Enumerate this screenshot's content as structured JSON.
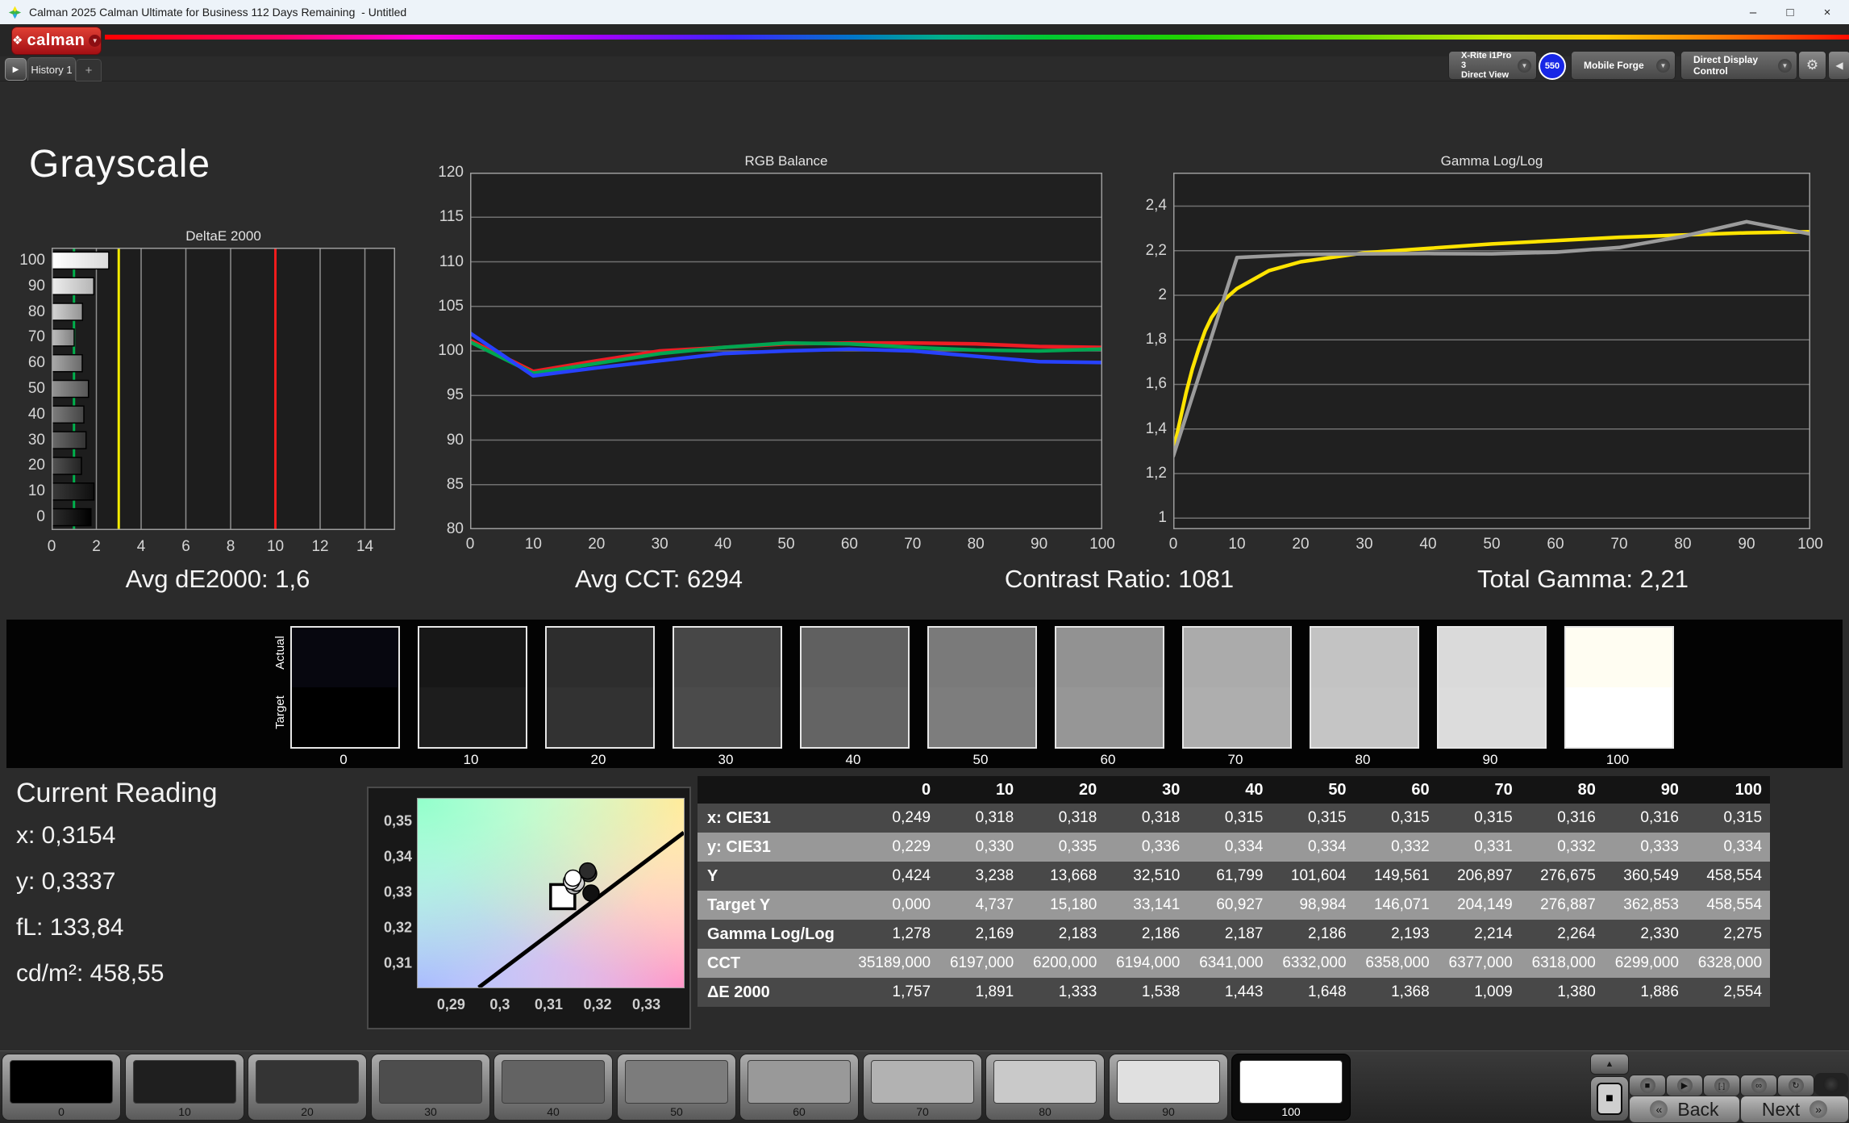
{
  "window": {
    "title": "Calman 2025 Calman Ultimate for Business 112 Days Remaining  - Untitled",
    "minimize": "–",
    "maximize": "□",
    "close": "×"
  },
  "brand": {
    "logo_text": "calman",
    "diamond": "❖",
    "caret": "▼",
    "accent_red": "#b5121b"
  },
  "tabs": {
    "panel_toggle_icon": "▶",
    "history": "History 1",
    "add": "+"
  },
  "meters": {
    "caret": "▼",
    "meter1_line1": "X-Rite i1Pro 3",
    "meter1_line2": "Direct View",
    "meter1_stripe": "#17d117",
    "meter1_badge": "550",
    "meter2_label": "Mobile Forge",
    "meter2_stripe": "#17d117",
    "meter3_label": "Direct Display Control",
    "meter3_stripe": "#e3d400",
    "gear_icon": "⚙",
    "collapse_icon": "◀"
  },
  "page": {
    "title": "Grayscale"
  },
  "summary": {
    "s1": "Avg dE2000: 1,6",
    "s2": "Avg CCT: 6294",
    "s3": "Contrast Ratio: 1081",
    "s4": "Total Gamma: 2,21"
  },
  "strip": {
    "actual_label": "Actual",
    "target_label": "Target",
    "items": [
      {
        "label": "0",
        "actual": "#07070f",
        "target": "#000000"
      },
      {
        "label": "10",
        "actual": "#171717",
        "target": "#1d1d1d"
      },
      {
        "label": "20",
        "actual": "#2d2d2d",
        "target": "#323232"
      },
      {
        "label": "30",
        "actual": "#474747",
        "target": "#4b4b4b"
      },
      {
        "label": "40",
        "actual": "#606060",
        "target": "#646464"
      },
      {
        "label": "50",
        "actual": "#7a7a7a",
        "target": "#7d7d7d"
      },
      {
        "label": "60",
        "actual": "#929292",
        "target": "#969696"
      },
      {
        "label": "70",
        "actual": "#ababab",
        "target": "#aeaeae"
      },
      {
        "label": "80",
        "actual": "#c3c3c3",
        "target": "#c5c5c5"
      },
      {
        "label": "90",
        "actual": "#dadada",
        "target": "#dcdcdc"
      },
      {
        "label": "100",
        "actual": "#fffdf2",
        "target": "#ffffff"
      }
    ]
  },
  "current_reading": {
    "title": "Current Reading",
    "x": "x: 0,3154",
    "y": "y: 0,3337",
    "fl": "fL: 133,84",
    "cd": "cd/m²: 458,55"
  },
  "table": {
    "columns": [
      "",
      "0",
      "10",
      "20",
      "30",
      "40",
      "50",
      "60",
      "70",
      "80",
      "90",
      "100"
    ],
    "rows": [
      {
        "label": "x: CIE31",
        "values": [
          "0,249",
          "0,318",
          "0,318",
          "0,318",
          "0,315",
          "0,315",
          "0,315",
          "0,315",
          "0,316",
          "0,316",
          "0,315"
        ]
      },
      {
        "label": "y: CIE31",
        "values": [
          "0,229",
          "0,330",
          "0,335",
          "0,336",
          "0,334",
          "0,334",
          "0,332",
          "0,331",
          "0,332",
          "0,333",
          "0,334"
        ]
      },
      {
        "label": "Y",
        "values": [
          "0,424",
          "3,238",
          "13,668",
          "32,510",
          "61,799",
          "101,604",
          "149,561",
          "206,897",
          "276,675",
          "360,549",
          "458,554"
        ]
      },
      {
        "label": "Target Y",
        "values": [
          "0,000",
          "4,737",
          "15,180",
          "33,141",
          "60,927",
          "98,984",
          "146,071",
          "204,149",
          "276,887",
          "362,853",
          "458,554"
        ]
      },
      {
        "label": "Gamma Log/Log",
        "values": [
          "1,278",
          "2,169",
          "2,183",
          "2,186",
          "2,187",
          "2,186",
          "2,193",
          "2,214",
          "2,264",
          "2,330",
          "2,275"
        ]
      },
      {
        "label": "CCT",
        "values": [
          "35189,000",
          "6197,000",
          "6200,000",
          "6194,000",
          "6341,000",
          "6332,000",
          "6358,000",
          "6377,000",
          "6318,000",
          "6299,000",
          "6328,000"
        ]
      },
      {
        "label": "ΔE 2000",
        "values": [
          "1,757",
          "1,891",
          "1,333",
          "1,538",
          "1,443",
          "1,648",
          "1,368",
          "1,009",
          "1,380",
          "1,886",
          "2,554"
        ]
      }
    ]
  },
  "bottom": {
    "patches": [
      {
        "label": "0",
        "color": "#000000"
      },
      {
        "label": "10",
        "color": "#1f1f1f"
      },
      {
        "label": "20",
        "color": "#343434"
      },
      {
        "label": "30",
        "color": "#4d4d4d"
      },
      {
        "label": "40",
        "color": "#636363"
      },
      {
        "label": "50",
        "color": "#7c7c7c"
      },
      {
        "label": "60",
        "color": "#999999"
      },
      {
        "label": "70",
        "color": "#b2b2b2"
      },
      {
        "label": "80",
        "color": "#c9c9c9"
      },
      {
        "label": "90",
        "color": "#e0e0e0"
      },
      {
        "label": "100",
        "color": "#ffffff"
      }
    ],
    "selected_label": "100",
    "back": "Back",
    "next": "Next",
    "back_chevron": "«",
    "next_chevron": "»",
    "icons": {
      "up": "▲",
      "square": "■",
      "stop": "■",
      "play": "▶",
      "step": "[·]",
      "loop": "∞",
      "refresh": "↻"
    }
  },
  "chart_data": [
    {
      "id": "deltae_2000",
      "type": "bar",
      "orientation": "horizontal",
      "title": "DeltaE 2000",
      "categories": [
        0,
        10,
        20,
        30,
        40,
        50,
        60,
        70,
        80,
        90,
        100
      ],
      "values": [
        1.757,
        1.891,
        1.333,
        1.538,
        1.443,
        1.648,
        1.368,
        1.009,
        1.38,
        1.886,
        2.554
      ],
      "display_order": "100-top-to-0-bottom",
      "xlim": [
        0,
        15.35
      ],
      "xticks": [
        0,
        2,
        4,
        6,
        8,
        10,
        12,
        14
      ],
      "grid": "vertical",
      "ref_lines": [
        {
          "x": 1,
          "color": "#00b14c"
        },
        {
          "x": 3,
          "color": "#f5ec00"
        },
        {
          "x": 10,
          "color": "#f01c1c"
        }
      ],
      "bar_fills": [
        [
          "#2e2e2e",
          "#000000"
        ],
        [
          "#3a3a3a",
          "#0e0e0e"
        ],
        [
          "#555555",
          "#222222"
        ],
        [
          "#6a6a6a",
          "#333333"
        ],
        [
          "#7e7e7e",
          "#454545"
        ],
        [
          "#949494",
          "#575757"
        ],
        [
          "#aaaaaa",
          "#6a6a6a"
        ],
        [
          "#bfbfbf",
          "#7e7e7e"
        ],
        [
          "#d5d5d5",
          "#939393"
        ],
        [
          "#eeeeee",
          "#b5b5b5"
        ],
        [
          "#ffffff",
          "#d9d9d9"
        ]
      ]
    },
    {
      "id": "rgb_balance",
      "type": "line",
      "title": "RGB Balance",
      "x": [
        0,
        10,
        20,
        30,
        40,
        50,
        60,
        70,
        80,
        90,
        100
      ],
      "xticks": [
        0,
        10,
        20,
        30,
        40,
        50,
        60,
        70,
        80,
        90,
        100
      ],
      "ylim": [
        80,
        120
      ],
      "yticks": [
        80,
        85,
        90,
        95,
        100,
        105,
        110,
        115,
        120
      ],
      "grid": "horizontal",
      "series": [
        {
          "name": "Red",
          "color": "#ed1c24",
          "values": [
            101.2,
            97.7,
            98.9,
            100.0,
            100.4,
            100.8,
            100.9,
            100.9,
            100.8,
            100.5,
            100.4
          ]
        },
        {
          "name": "Green",
          "color": "#00a651",
          "values": [
            101.0,
            97.5,
            98.6,
            99.7,
            100.4,
            100.9,
            100.8,
            100.4,
            100.1,
            100.0,
            100.2
          ]
        },
        {
          "name": "Blue",
          "color": "#2742ff",
          "values": [
            102.0,
            97.2,
            98.1,
            98.9,
            99.7,
            100.0,
            100.2,
            100.0,
            99.4,
            98.8,
            98.7
          ]
        }
      ]
    },
    {
      "id": "gamma_loglog",
      "type": "line",
      "title": "Gamma Log/Log",
      "xticks": [
        0,
        10,
        20,
        30,
        40,
        50,
        60,
        70,
        80,
        90,
        100
      ],
      "ylim": [
        0.95,
        2.55
      ],
      "yticks": [
        1,
        1.2,
        1.4,
        1.6,
        1.8,
        2,
        2.2,
        2.4
      ],
      "ytick_labels": [
        "1",
        "1,2",
        "1,4",
        "1,6",
        "1,8",
        "2",
        "2,2",
        "2,4"
      ],
      "grid": "horizontal",
      "series": [
        {
          "name": "Target",
          "color": "#ffe400",
          "x": [
            0,
            1,
            2,
            3,
            4,
            5,
            6,
            8,
            10,
            15,
            20,
            30,
            40,
            50,
            60,
            70,
            80,
            90,
            100
          ],
          "values": [
            1.3,
            1.43,
            1.56,
            1.67,
            1.76,
            1.84,
            1.9,
            1.98,
            2.03,
            2.11,
            2.15,
            2.19,
            2.21,
            2.23,
            2.245,
            2.26,
            2.27,
            2.28,
            2.285
          ]
        },
        {
          "name": "Measured",
          "color": "#9b9b9b",
          "x": [
            0,
            10,
            20,
            30,
            40,
            50,
            60,
            70,
            80,
            90,
            100
          ],
          "values": [
            1.278,
            2.169,
            2.183,
            2.186,
            2.187,
            2.186,
            2.193,
            2.214,
            2.264,
            2.33,
            2.275
          ]
        }
      ]
    },
    {
      "id": "cie_detail",
      "type": "scatter",
      "xlim": [
        0.283,
        0.3375
      ],
      "ylim": [
        0.3035,
        0.3565
      ],
      "xticks": [
        0.29,
        0.3,
        0.31,
        0.32,
        0.33
      ],
      "xtick_labels": [
        "0,29",
        "0,3",
        "0,31",
        "0,32",
        "0,33"
      ],
      "yticks": [
        0.31,
        0.32,
        0.33,
        0.34,
        0.35
      ],
      "ytick_labels": [
        "0,31",
        "0,32",
        "0,33",
        "0,34",
        "0,35"
      ],
      "locus": [
        [
          0.2955,
          0.3035
        ],
        [
          0.3375,
          0.347
        ]
      ],
      "target": {
        "x": 0.3127,
        "y": 0.329
      },
      "points": [
        {
          "x": 0.318,
          "y": 0.3355,
          "fill": "#3a3a3a"
        },
        {
          "x": 0.3178,
          "y": 0.3362,
          "fill": "#2b2b2b"
        },
        {
          "x": 0.3185,
          "y": 0.33,
          "fill": "#111111"
        },
        {
          "x": 0.315,
          "y": 0.332,
          "fill": "#b5b5b5"
        },
        {
          "x": 0.3155,
          "y": 0.3328,
          "fill": "#cfcfcf"
        },
        {
          "x": 0.3145,
          "y": 0.3333,
          "fill": "#e8e8e8"
        },
        {
          "x": 0.3148,
          "y": 0.3342,
          "fill": "#ffffff"
        }
      ]
    }
  ]
}
